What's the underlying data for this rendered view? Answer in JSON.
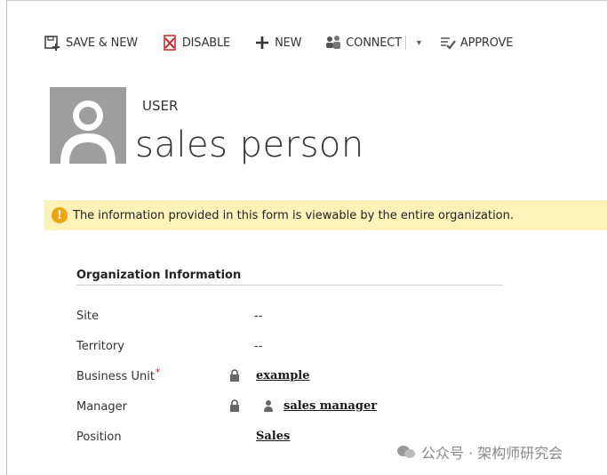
{
  "toolbar": {
    "save_new": "SAVE & NEW",
    "disable": "DISABLE",
    "new": "NEW",
    "connect": "CONNECT",
    "connect_dropdown": "▾",
    "approve": "APPROVE"
  },
  "header": {
    "entity_type": "USER",
    "record_name": "sales person"
  },
  "notice": {
    "text": "The information provided in this form is viewable by the entire organization."
  },
  "section": {
    "title": "Organization Information"
  },
  "fields": {
    "site": {
      "label": "Site",
      "value": "--"
    },
    "territory": {
      "label": "Territory",
      "value": "--"
    },
    "business_unit": {
      "label": "Business Unit",
      "required_mark": "*",
      "value": "example"
    },
    "manager": {
      "label": "Manager",
      "value": "sales manager"
    },
    "position": {
      "label": "Position",
      "value": "Sales"
    }
  },
  "watermark": {
    "text": "公众号 · 架构师研究会"
  },
  "colors": {
    "notice_bg": "#fdf2b8",
    "warning": "#f0a30a",
    "required": "#ee1111"
  }
}
